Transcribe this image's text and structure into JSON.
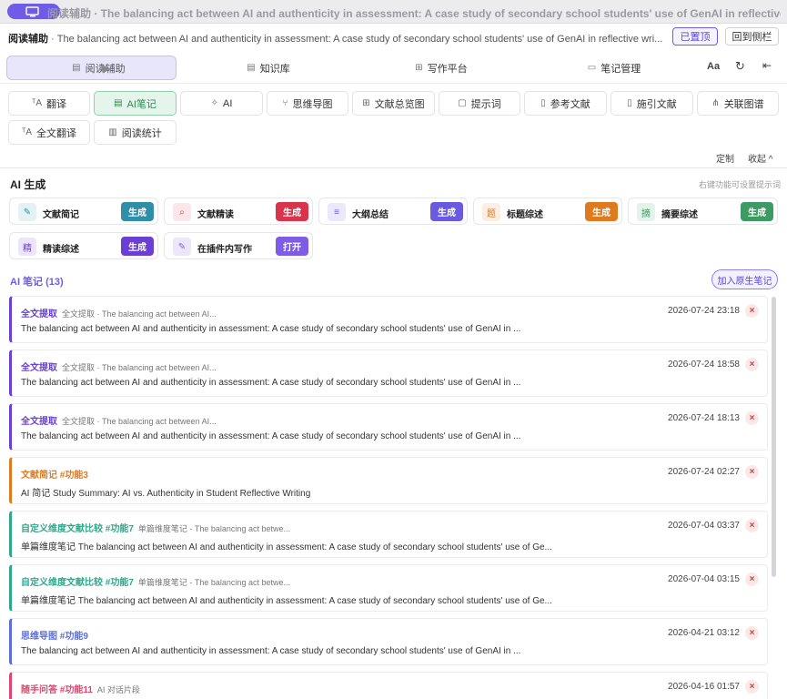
{
  "titlebar": {
    "title": "阅读辅助 · The balancing act between AI and authenticity in assessment: A case study of secondary school students' use of GenAI in reflective wr..."
  },
  "header": {
    "label": "阅读辅助",
    "doc_title": " · The balancing act between AI and authenticity in assessment: A case study of secondary school students' use of GenAI in reflective wri...",
    "pinned_label": "已置顶",
    "back_sidebar_label": "回到侧栏"
  },
  "nav": {
    "tabs": [
      {
        "label": "阅读辅助",
        "icon": "document-icon"
      },
      {
        "label": "知识库",
        "icon": "database-icon"
      },
      {
        "label": "写作平台",
        "icon": "grid-icon"
      },
      {
        "label": "笔记管理",
        "icon": "folder-icon"
      }
    ],
    "font_label": "Aa",
    "refresh_icon": "refresh-icon",
    "collapse_icon": "collapse-left-icon"
  },
  "tools": {
    "row1": [
      {
        "label": "翻译",
        "icon": "translate-icon"
      },
      {
        "label": "AI笔记",
        "icon": "note-icon"
      },
      {
        "label": "AI",
        "icon": "sparkle-icon"
      },
      {
        "label": "思维导图",
        "icon": "mindmap-icon"
      },
      {
        "label": "文献总览图",
        "icon": "grid-icon"
      },
      {
        "label": "提示词",
        "icon": "chat-icon"
      },
      {
        "label": "参考文献",
        "icon": "file-icon"
      },
      {
        "label": "施引文献",
        "icon": "file-icon"
      },
      {
        "label": "关联图谱",
        "icon": "graph-icon"
      }
    ],
    "row2": [
      {
        "label": "全文翻译",
        "icon": "translate-icon"
      },
      {
        "label": "阅读统计",
        "icon": "bar-chart-icon"
      }
    ]
  },
  "mini_links": {
    "customize": "定制",
    "collapse": "收起",
    "collapse_arrow": "^"
  },
  "ai_gen": {
    "title": "AI 生成",
    "hint": "右键功能可设置提示词",
    "cards": [
      {
        "label": "文献简记",
        "icon_char": "✎",
        "button": "生成",
        "btn_color": "#2f8fa8",
        "ic_bg": "#e4f1f5",
        "ic_color": "#2f8fa8"
      },
      {
        "label": "文献精读",
        "icon_char": "⌕",
        "button": "生成",
        "btn_color": "#d8344b",
        "ic_bg": "#fbe6ea",
        "ic_color": "#d8344b"
      },
      {
        "label": "大纲总结",
        "icon_char": "≡",
        "button": "生成",
        "btn_color": "#6a5ae0",
        "ic_bg": "#ebe8fb",
        "ic_color": "#6a5ae0"
      },
      {
        "label": "标题综述",
        "icon_char": "题",
        "button": "生成",
        "btn_color": "#e07a1f",
        "ic_bg": "#fcefe1",
        "ic_color": "#e07a1f"
      },
      {
        "label": "摘要综述",
        "icon_char": "摘",
        "button": "生成",
        "btn_color": "#3e9a63",
        "ic_bg": "#e3f3e9",
        "ic_color": "#3e9a63"
      },
      {
        "label": "精读综述",
        "icon_char": "精",
        "button": "生成",
        "btn_color": "#6b3fd3",
        "ic_bg": "#ece4fb",
        "ic_color": "#6b3fd3"
      },
      {
        "label": "在插件内写作",
        "icon_char": "✎",
        "button": "打开",
        "btn_color": "#7e5ce6",
        "ic_bg": "#ece6fb",
        "ic_color": "#7e5ce6"
      }
    ]
  },
  "notes": {
    "title": "AI 笔记 (13)",
    "add_native_label": "加入原生笔记",
    "items": [
      {
        "tag": "全文提取",
        "sub": "全文提取 · The balancing act between AI...",
        "date": "2026-07-24 23:18",
        "body": "The balancing act between AI and authenticity in assessment: A case study of secondary school students' use of GenAI in ...",
        "color": "#6a3fd6"
      },
      {
        "tag": "全文提取",
        "sub": "全文提取 · The balancing act between AI...",
        "date": "2026-07-24 18:58",
        "body": "The balancing act between AI and authenticity in assessment: A case study of secondary school students' use of GenAI in ...",
        "color": "#6a3fd6"
      },
      {
        "tag": "全文提取",
        "sub": "全文提取 · The balancing act between AI...",
        "date": "2026-07-24 18:13",
        "body": "The balancing act between AI and authenticity in assessment: A case study of secondary school students' use of GenAI in ...",
        "color": "#6a3fd6"
      },
      {
        "tag": "文献简记 #功能3",
        "sub": "",
        "date": "2026-07-24 02:27",
        "body": "AI 简记 Study Summary: AI vs. Authenticity in Student Reflective Writing",
        "color": "#e07a1f"
      },
      {
        "tag": "自定义维度文献比较 #功能7",
        "sub": "单篇维度笔记 - The balancing act betwe...",
        "date": "2026-07-04 03:37",
        "body": "单篇维度笔记 The balancing act between AI and authenticity in assessment: A case study of secondary school students' use of Ge...",
        "color": "#2fa88a"
      },
      {
        "tag": "自定义维度文献比较 #功能7",
        "sub": "单篇维度笔记 - The balancing act betwe...",
        "date": "2026-07-04 03:15",
        "body": "单篇维度笔记 The balancing act between AI and authenticity in assessment: A case study of secondary school students' use of Ge...",
        "color": "#2fa88a"
      },
      {
        "tag": "思维导图 #功能9",
        "sub": "",
        "date": "2026-04-21 03:12",
        "body": "The balancing act between AI and authenticity in assessment: A case study of secondary school students' use of GenAI in ...",
        "color": "#5a6ee0"
      },
      {
        "tag": "随手问答 #功能11",
        "sub": "AI 对话片段",
        "date": "2026-04-16 01:57",
        "body": "",
        "color": "#e0456e"
      }
    ]
  }
}
